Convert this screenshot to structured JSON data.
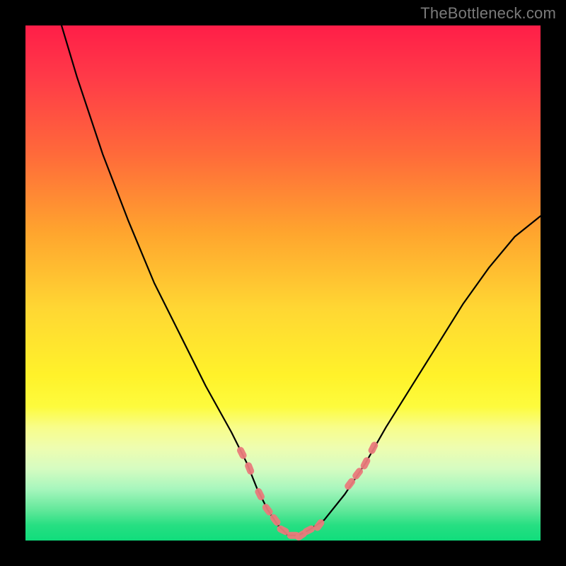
{
  "watermark": "TheBottleneck.com",
  "colors": {
    "frame": "#000000",
    "curve": "#000000",
    "tick": "#e97a7b"
  },
  "chart_data": {
    "type": "line",
    "title": "",
    "xlabel": "",
    "ylabel": "",
    "xlim": [
      0,
      100
    ],
    "ylim": [
      0,
      100
    ],
    "grid": false,
    "legend": false,
    "series": [
      {
        "name": "curve",
        "x": [
          7,
          10,
          15,
          20,
          25,
          30,
          35,
          40,
          43,
          45,
          47,
          49,
          51,
          53,
          55,
          58,
          62,
          66,
          70,
          75,
          80,
          85,
          90,
          95,
          100
        ],
        "y": [
          100,
          90,
          75,
          62,
          50,
          40,
          30,
          21,
          15,
          10,
          6,
          3,
          1,
          1,
          2,
          4,
          9,
          15,
          22,
          30,
          38,
          46,
          53,
          59,
          63
        ]
      }
    ],
    "ticks_on_curve": {
      "name": "markers",
      "x": [
        42,
        43.5,
        45.5,
        47,
        48.5,
        50,
        52,
        53.5,
        55,
        57,
        63,
        64.5,
        66,
        67.5
      ],
      "y": [
        17,
        14,
        9,
        6,
        4,
        2,
        1,
        1,
        2,
        3,
        11,
        13,
        15,
        18
      ]
    }
  }
}
